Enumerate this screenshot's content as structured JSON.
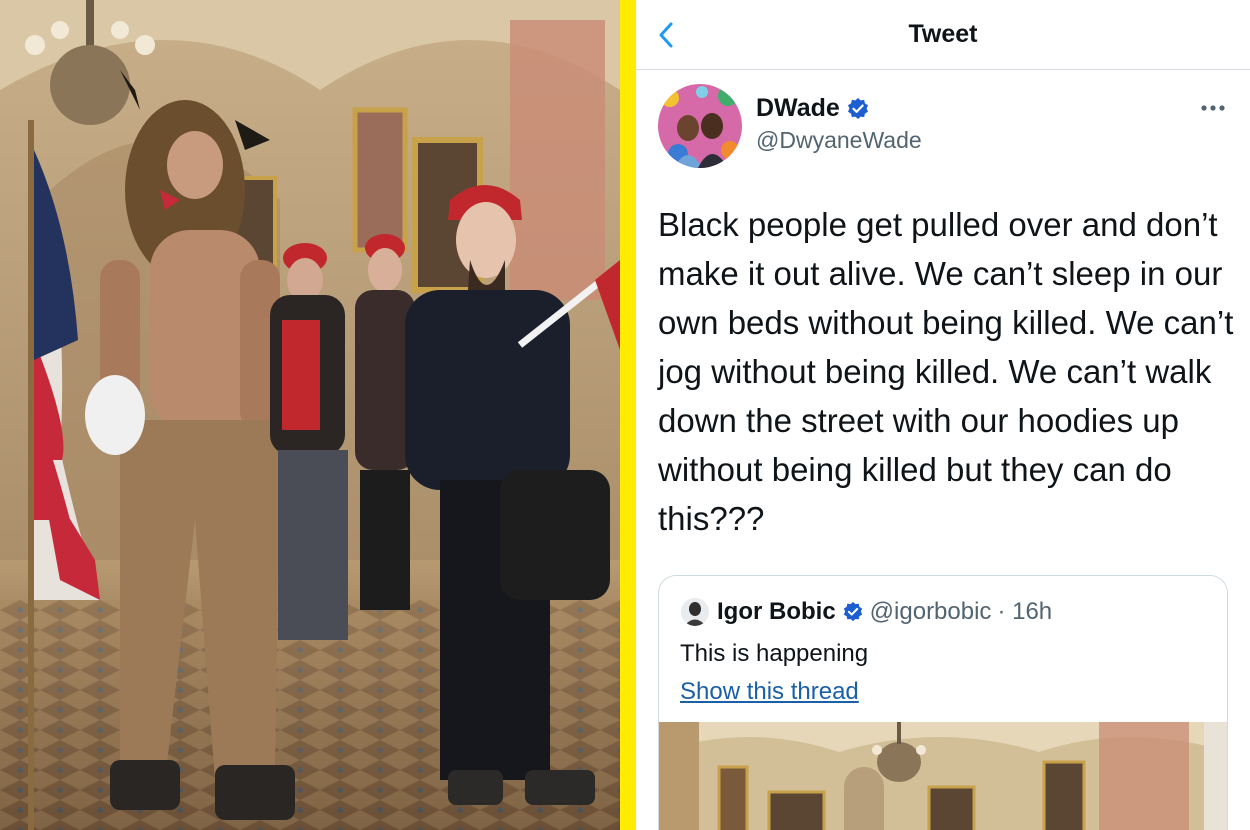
{
  "header": {
    "title": "Tweet",
    "back_icon": "chevron-left-icon"
  },
  "tweet": {
    "author_name": "DWade",
    "author_handle": "@DwyaneWade",
    "verified_icon": "verified-badge-icon",
    "more_icon": "more-horizontal-icon",
    "text": "Black people get pulled over and don’t make it out alive. We can’t sleep in our own beds without being killed. We can’t jog without being killed. We can’t walk down the street with our hoodies up without being killed but they can do this???"
  },
  "quoted_tweet": {
    "author_name": "Igor Bobic",
    "author_handle": "@igorbobic",
    "time": "· 16h",
    "text": "This is happening",
    "link_label": "Show this thread"
  },
  "colors": {
    "divider": "#ffec00",
    "link": "#1a5fa8",
    "verified": "#1d5fd1"
  }
}
